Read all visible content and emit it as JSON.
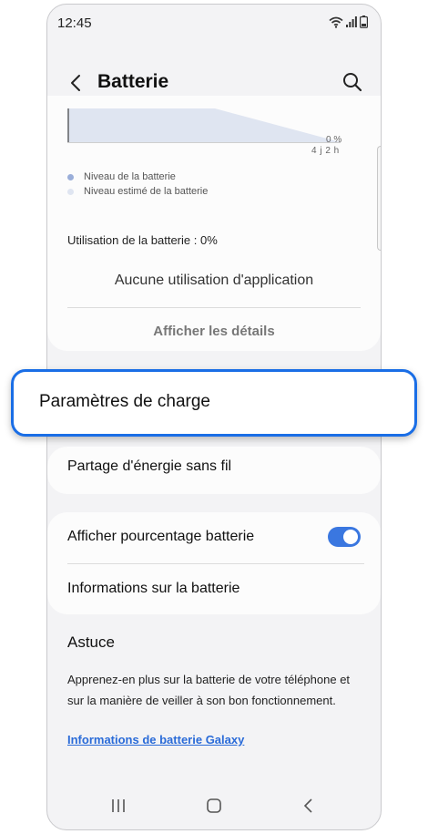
{
  "status_bar": {
    "time": "12:45"
  },
  "header": {
    "title": "Batterie"
  },
  "chart": {
    "percent_label": "0 %",
    "time_label": "4 j 2 h",
    "legend": [
      {
        "label": "Niveau de la batterie",
        "color": "#9aaed9"
      },
      {
        "label": "Niveau estimé de la batterie",
        "color": "#dfe5f1"
      }
    ],
    "usage_label": "Utilisation de la batterie : 0%",
    "no_usage_text": "Aucune utilisation d'application",
    "details_button": "Afficher les détails"
  },
  "settings": {
    "charging_settings": "Paramètres de charge",
    "wireless_powershare": "Partage d'énergie sans fil",
    "show_percentage": "Afficher pourcentage batterie",
    "show_percentage_enabled": true,
    "battery_info": "Informations sur la batterie"
  },
  "tip": {
    "title": "Astuce",
    "body": "Apprenez-en plus sur la batterie de votre téléphone et sur la manière de veiller à son bon fonctionnement.",
    "link": "Informations de batterie Galaxy"
  },
  "colors": {
    "accent": "#1a6ee6",
    "toggle_on": "#3a77e0",
    "link": "#2a6bd8"
  },
  "icons": [
    "wifi-icon",
    "signal-icon",
    "battery-icon",
    "back-arrow-icon",
    "search-icon",
    "recent-apps-icon",
    "home-icon",
    "nav-back-icon"
  ]
}
